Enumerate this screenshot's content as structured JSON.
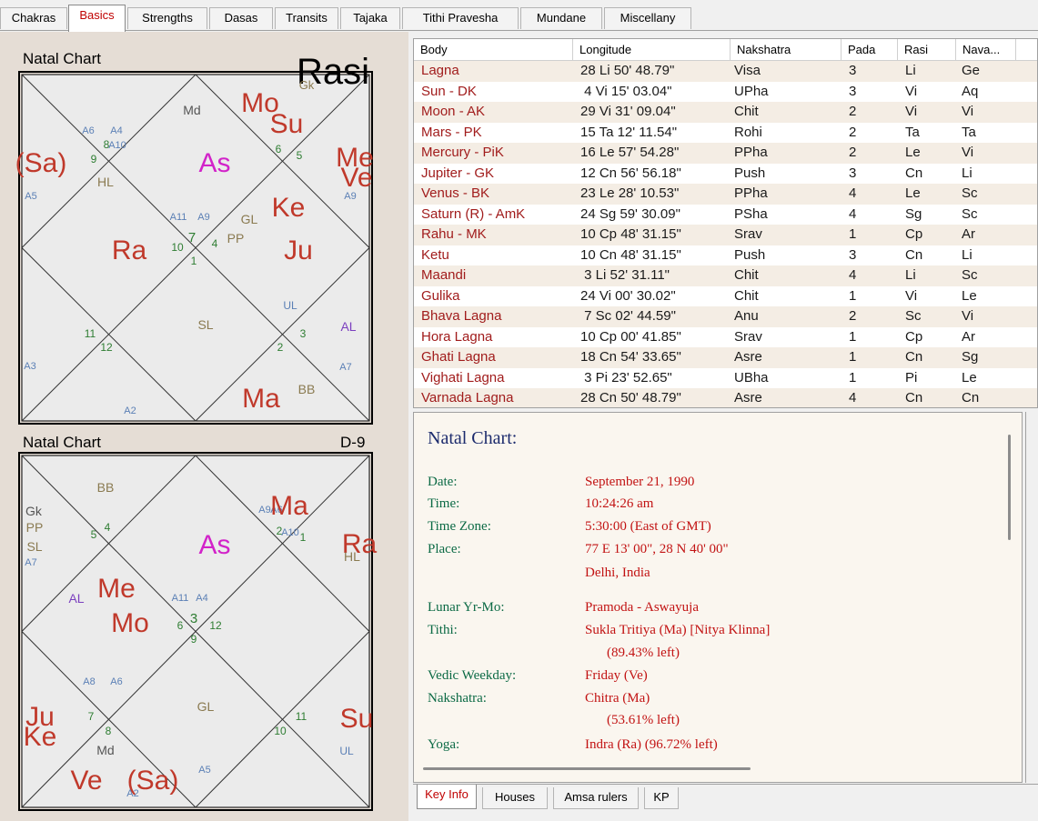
{
  "top_tabs": [
    {
      "label": "Chakras"
    },
    {
      "label": "Basics",
      "active": true
    },
    {
      "label": "Strengths"
    },
    {
      "label": "Dasas"
    },
    {
      "label": "Transits"
    },
    {
      "label": "Tajaka"
    },
    {
      "label": "Tithi Pravesha"
    },
    {
      "label": "Mundane"
    },
    {
      "label": "Miscellany"
    }
  ],
  "rasi_chart": {
    "title": "Natal Chart",
    "division": "Rasi",
    "labels": [
      {
        "text": "Mo",
        "color": "#c0392b",
        "size": 30
      },
      {
        "text": "Su",
        "color": "#c0392b",
        "size": 30
      },
      {
        "text": "Gk",
        "color": "#8a7a50",
        "size": 13
      },
      {
        "text": "Md",
        "color": "#555555",
        "size": 14
      },
      {
        "text": "A6",
        "color": "#5a7fb5",
        "size": 11
      },
      {
        "text": "A4",
        "color": "#5a7fb5",
        "size": 11
      },
      {
        "text": "8",
        "color": "#2e7d32",
        "size": 12
      },
      {
        "text": "A10",
        "color": "#5a7fb5",
        "size": 11
      },
      {
        "text": "9",
        "color": "#2e7d32",
        "size": 12
      },
      {
        "text": "(Sa)",
        "color": "#c0392b",
        "size": 30
      },
      {
        "text": "As",
        "color": "#d223c9",
        "size": 30
      },
      {
        "text": "6",
        "color": "#2e7d32",
        "size": 12
      },
      {
        "text": "5",
        "color": "#2e7d32",
        "size": 12
      },
      {
        "text": "Me",
        "color": "#c0392b",
        "size": 30
      },
      {
        "text": "Ve",
        "color": "#c0392b",
        "size": 30
      },
      {
        "text": "A5",
        "color": "#5a7fb5",
        "size": 11
      },
      {
        "text": "HL",
        "color": "#8a7a50",
        "size": 14
      },
      {
        "text": "Ke",
        "color": "#c0392b",
        "size": 30
      },
      {
        "text": "A9",
        "color": "#5a7fb5",
        "size": 11
      },
      {
        "text": "A11",
        "color": "#5a7fb5",
        "size": 11
      },
      {
        "text": "A9",
        "color": "#5a7fb5",
        "size": 11
      },
      {
        "text": "GL",
        "color": "#8a7a50",
        "size": 14
      },
      {
        "text": "7",
        "color": "#2e7d32",
        "size": 15
      },
      {
        "text": "10",
        "color": "#2e7d32",
        "size": 12
      },
      {
        "text": "4",
        "color": "#2e7d32",
        "size": 12
      },
      {
        "text": "PP",
        "color": "#8a7a50",
        "size": 14
      },
      {
        "text": "1",
        "color": "#2e7d32",
        "size": 12
      },
      {
        "text": "Ra",
        "color": "#c0392b",
        "size": 30
      },
      {
        "text": "Ju",
        "color": "#c0392b",
        "size": 30
      },
      {
        "text": "UL",
        "color": "#5a7fb5",
        "size": 12
      },
      {
        "text": "SL",
        "color": "#8a7a50",
        "size": 14
      },
      {
        "text": "AL",
        "color": "#7b3fbf",
        "size": 14
      },
      {
        "text": "11",
        "color": "#2e7d32",
        "size": 12
      },
      {
        "text": "3",
        "color": "#2e7d32",
        "size": 12
      },
      {
        "text": "12",
        "color": "#2e7d32",
        "size": 12
      },
      {
        "text": "2",
        "color": "#2e7d32",
        "size": 12
      },
      {
        "text": "A3",
        "color": "#5a7fb5",
        "size": 11
      },
      {
        "text": "A7",
        "color": "#5a7fb5",
        "size": 11
      },
      {
        "text": "BB",
        "color": "#8a7a50",
        "size": 14
      },
      {
        "text": "Ma",
        "color": "#c0392b",
        "size": 30
      },
      {
        "text": "A2",
        "color": "#5a7fb5",
        "size": 11
      }
    ]
  },
  "navamsa_chart": {
    "title": "Natal Chart",
    "division": "D-9",
    "labels": [
      {
        "text": "BB",
        "color": "#8a7a50",
        "size": 14
      },
      {
        "text": "A9",
        "color": "#5a7fb5",
        "size": 11
      },
      {
        "text": "A6",
        "color": "#5a7fb5",
        "size": 11
      },
      {
        "text": "Ma",
        "color": "#c0392b",
        "size": 30
      },
      {
        "text": "Gk",
        "color": "#555555",
        "size": 14
      },
      {
        "text": "PP",
        "color": "#8a7a50",
        "size": 14
      },
      {
        "text": "5",
        "color": "#2e7d32",
        "size": 12
      },
      {
        "text": "4",
        "color": "#2e7d32",
        "size": 12
      },
      {
        "text": "As",
        "color": "#d223c9",
        "size": 30
      },
      {
        "text": "2",
        "color": "#2e7d32",
        "size": 12
      },
      {
        "text": "A10",
        "color": "#5a7fb5",
        "size": 11
      },
      {
        "text": "1",
        "color": "#2e7d32",
        "size": 12
      },
      {
        "text": "Ra",
        "color": "#c0392b",
        "size": 30
      },
      {
        "text": "SL",
        "color": "#8a7a50",
        "size": 14
      },
      {
        "text": "A7",
        "color": "#5a7fb5",
        "size": 11
      },
      {
        "text": "HL",
        "color": "#8a7a50",
        "size": 14
      },
      {
        "text": "Me",
        "color": "#c0392b",
        "size": 30
      },
      {
        "text": "AL",
        "color": "#7b3fbf",
        "size": 14
      },
      {
        "text": "A11",
        "color": "#5a7fb5",
        "size": 11
      },
      {
        "text": "A4",
        "color": "#5a7fb5",
        "size": 11
      },
      {
        "text": "3",
        "color": "#2e7d32",
        "size": 15
      },
      {
        "text": "Mo",
        "color": "#c0392b",
        "size": 30
      },
      {
        "text": "6",
        "color": "#2e7d32",
        "size": 12
      },
      {
        "text": "12",
        "color": "#2e7d32",
        "size": 12
      },
      {
        "text": "9",
        "color": "#2e7d32",
        "size": 12
      },
      {
        "text": "A8",
        "color": "#5a7fb5",
        "size": 11
      },
      {
        "text": "A6",
        "color": "#5a7fb5",
        "size": 11
      },
      {
        "text": "GL",
        "color": "#8a7a50",
        "size": 14
      },
      {
        "text": "7",
        "color": "#2e7d32",
        "size": 12
      },
      {
        "text": "11",
        "color": "#2e7d32",
        "size": 12
      },
      {
        "text": "Ju",
        "color": "#c0392b",
        "size": 30
      },
      {
        "text": "8",
        "color": "#2e7d32",
        "size": 12
      },
      {
        "text": "10",
        "color": "#2e7d32",
        "size": 12
      },
      {
        "text": "Su",
        "color": "#c0392b",
        "size": 30
      },
      {
        "text": "Ke",
        "color": "#c0392b",
        "size": 30
      },
      {
        "text": "Md",
        "color": "#555555",
        "size": 14
      },
      {
        "text": "UL",
        "color": "#5a7fb5",
        "size": 12
      },
      {
        "text": "A5",
        "color": "#5a7fb5",
        "size": 11
      },
      {
        "text": "Ve",
        "color": "#c0392b",
        "size": 30
      },
      {
        "text": "(Sa)",
        "color": "#c0392b",
        "size": 30
      },
      {
        "text": "A2",
        "color": "#5a7fb5",
        "size": 11
      }
    ]
  },
  "table": {
    "headers": [
      "Body",
      "Longitude",
      "Nakshatra",
      "Pada",
      "Rasi",
      "Nava..."
    ],
    "rows": [
      [
        "Lagna",
        "28 Li 50' 48.79\"",
        "Visa",
        "3",
        "Li",
        "Ge"
      ],
      [
        "Sun - DK",
        " 4 Vi 15' 03.04\"",
        "UPha",
        "3",
        "Vi",
        "Aq"
      ],
      [
        "Moon - AK",
        "29 Vi 31' 09.04\"",
        "Chit",
        "2",
        "Vi",
        "Vi"
      ],
      [
        "Mars - PK",
        "15 Ta 12' 11.54\"",
        "Rohi",
        "2",
        "Ta",
        "Ta"
      ],
      [
        "Mercury - PiK",
        "16 Le 57' 54.28\"",
        "PPha",
        "2",
        "Le",
        "Vi"
      ],
      [
        "Jupiter - GK",
        "12 Cn 56' 56.18\"",
        "Push",
        "3",
        "Cn",
        "Li"
      ],
      [
        "Venus - BK",
        "23 Le 28' 10.53\"",
        "PPha",
        "4",
        "Le",
        "Sc"
      ],
      [
        "Saturn (R) - AmK",
        "24 Sg 59' 30.09\"",
        "PSha",
        "4",
        "Sg",
        "Sc"
      ],
      [
        "Rahu - MK",
        "10 Cp 48' 31.15\"",
        "Srav",
        "1",
        "Cp",
        "Ar"
      ],
      [
        "Ketu",
        "10 Cn 48' 31.15\"",
        "Push",
        "3",
        "Cn",
        "Li"
      ],
      [
        "Maandi",
        " 3 Li 52' 31.11\"",
        "Chit",
        "4",
        "Li",
        "Sc"
      ],
      [
        "Gulika",
        "24 Vi 00' 30.02\"",
        "Chit",
        "1",
        "Vi",
        "Le"
      ],
      [
        "Bhava Lagna",
        " 7 Sc 02' 44.59\"",
        "Anu",
        "2",
        "Sc",
        "Vi"
      ],
      [
        "Hora Lagna",
        "10 Cp 00' 41.85\"",
        "Srav",
        "1",
        "Cp",
        "Ar"
      ],
      [
        "Ghati Lagna",
        "18 Cn 54' 33.65\"",
        "Asre",
        "1",
        "Cn",
        "Sg"
      ],
      [
        "Vighati Lagna",
        " 3 Pi 23' 52.65\"",
        "UBha",
        "1",
        "Pi",
        "Le"
      ],
      [
        "Varnada Lagna",
        "28 Cn 50' 48.79\"",
        "Asre",
        "4",
        "Cn",
        "Cn"
      ]
    ]
  },
  "info": {
    "title": "Natal Chart:",
    "entries": [
      {
        "label": "Date:",
        "value": "September 21, 1990"
      },
      {
        "label": "Time:",
        "value": "10:24:26 am"
      },
      {
        "label": "Time Zone:",
        "value": "5:30:00 (East of GMT)"
      },
      {
        "label": "Place:",
        "value": "77 E 13' 00\", 28 N 40' 00\""
      },
      {
        "label": "",
        "value": "Delhi, India"
      },
      {
        "label": "Lunar Yr-Mo:",
        "value": "Pramoda - Aswayuja"
      },
      {
        "label": "Tithi:",
        "value": "Sukla Tritiya (Ma) [Nitya Klinna]"
      },
      {
        "label": "",
        "value": "(89.43% left)"
      },
      {
        "label": "Vedic Weekday:",
        "value": "Friday (Ve)"
      },
      {
        "label": "Nakshatra:",
        "value": "Chitra (Ma)"
      },
      {
        "label": "",
        "value": "(53.61% left)"
      },
      {
        "label": "Yoga:",
        "value": "Indra (Ra) (96.72% left)"
      }
    ]
  },
  "bottom_tabs": [
    {
      "label": "Key Info",
      "active": true
    },
    {
      "label": "Houses"
    },
    {
      "label": "Amsa rulers"
    },
    {
      "label": "KP"
    }
  ]
}
